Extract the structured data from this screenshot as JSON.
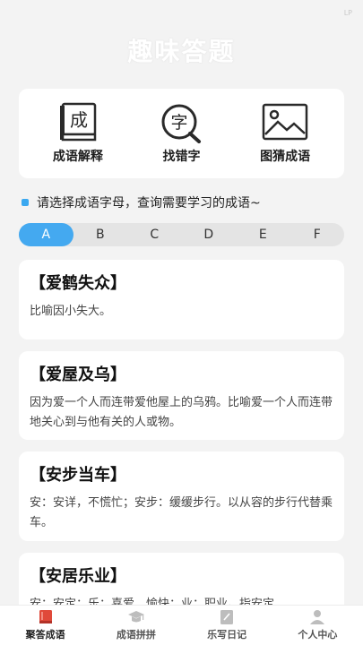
{
  "status": {
    "tag": "LP"
  },
  "app": {
    "title": "趣味答题"
  },
  "features": [
    {
      "label": "成语解释",
      "icon": "book-icon",
      "glyph": "成"
    },
    {
      "label": "找错字",
      "icon": "magnifier-char-icon",
      "glyph": "字"
    },
    {
      "label": "图猜成语",
      "icon": "picture-icon"
    }
  ],
  "hint": {
    "text": "请选择成语字母，查询需要学习的成语~"
  },
  "letters": {
    "items": [
      "A",
      "B",
      "C",
      "D",
      "E",
      "F"
    ],
    "selected": "A"
  },
  "idioms": [
    {
      "title": "【爱鹤失众】",
      "desc": "比喻因小失大。"
    },
    {
      "title": "【爱屋及乌】",
      "desc": "因为爱一个人而连带爱他屋上的乌鸦。比喻爱一个人而连带地关心到与他有关的人或物。"
    },
    {
      "title": "【安步当车】",
      "desc": "安：安详，不慌忙；安步：缓缓步行。以从容的步行代替乘车。"
    },
    {
      "title": "【安居乐业】",
      "desc": "安：安定；乐：喜爱，愉快；业：职业。指安定"
    }
  ],
  "nav": [
    {
      "label": "聚答成语",
      "icon": "book-icon"
    },
    {
      "label": "成语拼拼",
      "icon": "graduation-cap-icon"
    },
    {
      "label": "乐写日记",
      "icon": "notebook-icon"
    },
    {
      "label": "个人中心",
      "icon": "person-icon"
    }
  ],
  "colors": {
    "accent": "#44a9f0",
    "active_nav": "#e0493a"
  }
}
